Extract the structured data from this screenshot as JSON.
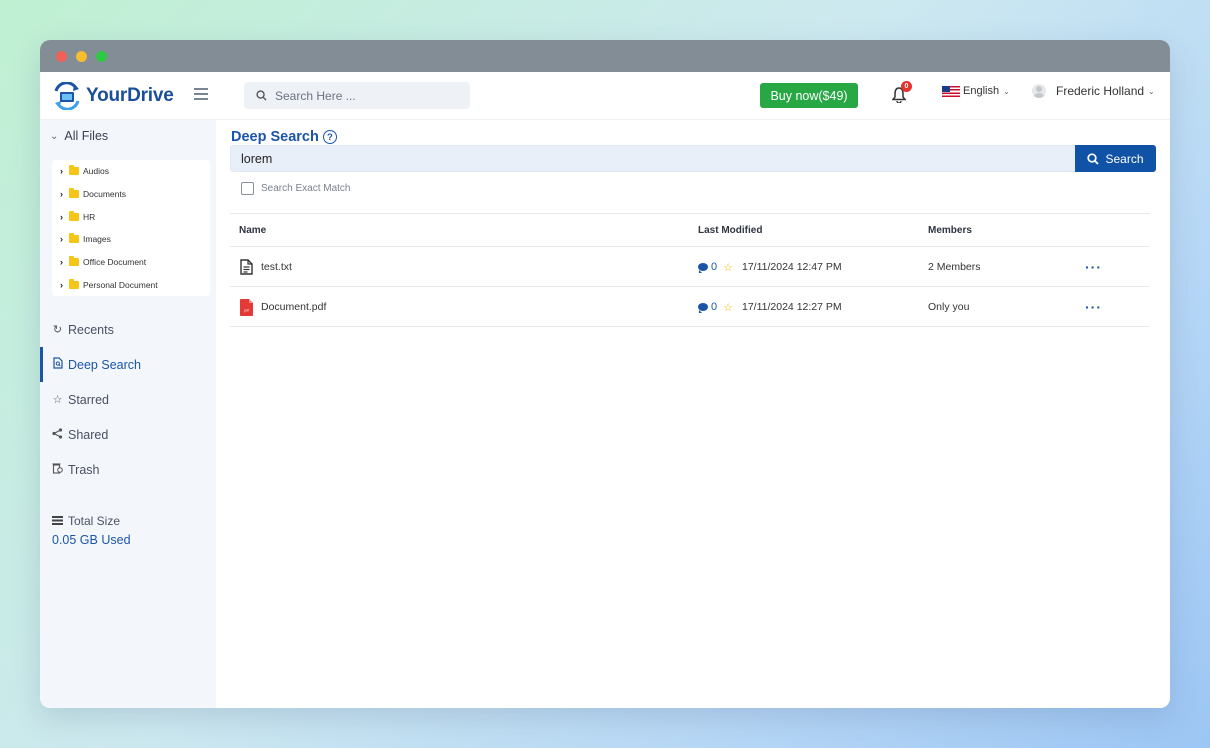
{
  "app": {
    "name": "YourDrive",
    "search_placeholder": "Search Here ...",
    "buy_label": "Buy now($49)",
    "notification_count": "0",
    "language": "English",
    "user_name": "Frederic Holland"
  },
  "sidebar": {
    "all_files": "All Files",
    "folders": [
      "Audios",
      "Documents",
      "HR",
      "Images",
      "Office Document",
      "Personal Document"
    ],
    "nav": [
      {
        "label": "Recents",
        "icon": "history-icon"
      },
      {
        "label": "Deep Search",
        "icon": "file-search-icon"
      },
      {
        "label": "Starred",
        "icon": "star-icon"
      },
      {
        "label": "Shared",
        "icon": "share-icon"
      },
      {
        "label": "Trash",
        "icon": "trash-icon"
      }
    ],
    "total_size_label": "Total Size",
    "used_label": "0.05 GB Used"
  },
  "main": {
    "title": "Deep Search",
    "query": "lorem",
    "search_button": "Search",
    "exact_match_label": "Search Exact Match",
    "columns": {
      "name": "Name",
      "modified": "Last Modified",
      "members": "Members"
    },
    "rows": [
      {
        "name": "test.txt",
        "icon": "text-file-icon",
        "comments": "0",
        "modified": "17/11/2024 12:47 PM",
        "members": "2 Members"
      },
      {
        "name": "Document.pdf",
        "icon": "pdf-file-icon",
        "comments": "0",
        "modified": "17/11/2024 12:27 PM",
        "members": "Only you"
      }
    ]
  },
  "colors": {
    "primary": "#1b55a8",
    "buy": "#28a745",
    "folder": "#f5c518",
    "pdf": "#e53935"
  }
}
